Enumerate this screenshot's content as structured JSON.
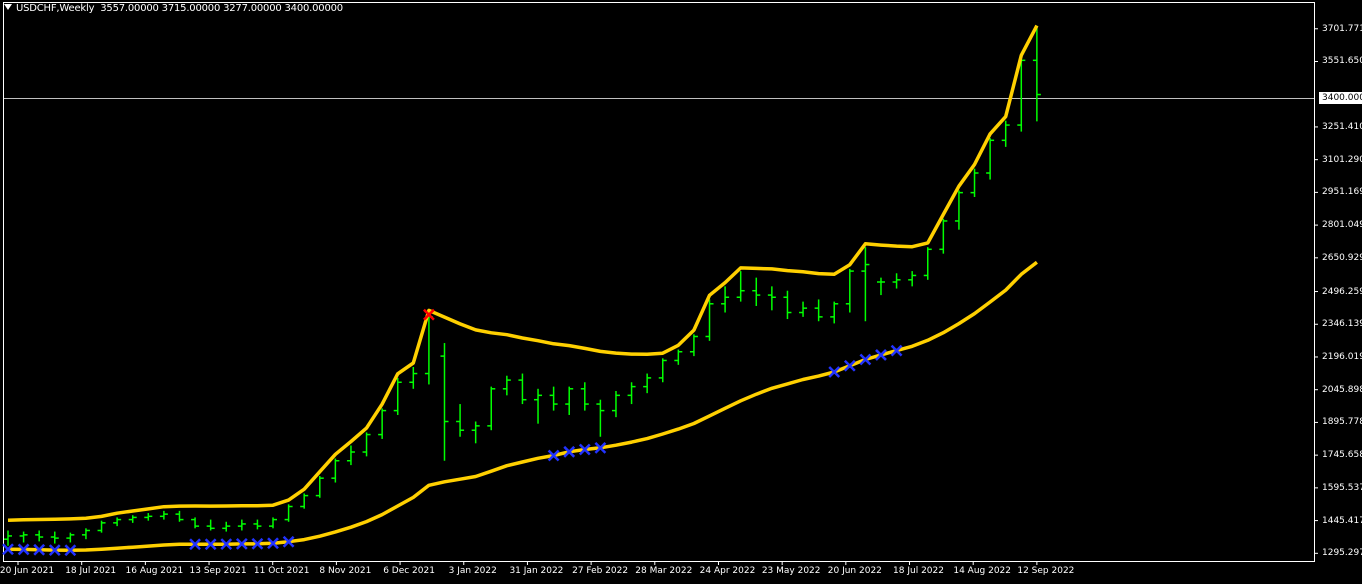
{
  "header": {
    "symbol": "USDCHF,Weekly",
    "ohlc": "3557.00000 3715.00000 3277.00000 3400.00000"
  },
  "current_price_label": "3400.0000",
  "colors": {
    "background": "#000000",
    "frame": "#ffffff",
    "bars": "#00ff00",
    "bands": "#ffd000",
    "marker_blue": "#2233ff",
    "marker_red": "#ff0000"
  },
  "chart_data": {
    "type": "ohlc-bar",
    "y_tick_labels": [
      "3701.7712",
      "3551.6505",
      "3400.0000",
      "3251.4103",
      "3101.2900",
      "2951.1697",
      "2801.0494",
      "2650.9291",
      "2496.2597",
      "2346.1394",
      "2196.0191",
      "2045.8988",
      "1895.7785",
      "1745.6582",
      "1595.5379",
      "1445.4176",
      "1295.2973"
    ],
    "y_tick_values": [
      3701.7712,
      3551.6505,
      3400.0,
      3251.4103,
      3101.29,
      2951.1697,
      2801.0494,
      2650.9291,
      2496.2597,
      2346.1394,
      2196.0191,
      2045.8988,
      1895.7785,
      1745.6582,
      1595.5379,
      1445.4176,
      1295.2973
    ],
    "ylim": [
      1260,
      3820
    ],
    "x_labels": [
      {
        "label": "20 Jun 2021",
        "bar": 0
      },
      {
        "label": "18 Jul 2021",
        "bar": 4
      },
      {
        "label": "16 Aug 2021",
        "bar": 8
      },
      {
        "label": "13 Sep 2021",
        "bar": 12
      },
      {
        "label": "11 Oct 2021",
        "bar": 16
      },
      {
        "label": "8 Nov 2021",
        "bar": 20
      },
      {
        "label": "6 Dec 2021",
        "bar": 24
      },
      {
        "label": "3 Jan 2022",
        "bar": 28
      },
      {
        "label": "31 Jan 2022",
        "bar": 32
      },
      {
        "label": "27 Feb 2022",
        "bar": 36
      },
      {
        "label": "28 Mar 2022",
        "bar": 40
      },
      {
        "label": "24 Apr 2022",
        "bar": 44
      },
      {
        "label": "23 May 2022",
        "bar": 48
      },
      {
        "label": "20 Jun 2022",
        "bar": 52
      },
      {
        "label": "18 Jul 2022",
        "bar": 56
      },
      {
        "label": "14 Aug 2022",
        "bar": 60
      },
      {
        "label": "12 Sep 2022",
        "bar": 64
      }
    ],
    "bars": [
      {
        "o": 1360,
        "h": 1400,
        "l": 1330,
        "c": 1375
      },
      {
        "o": 1375,
        "h": 1395,
        "l": 1345,
        "c": 1380
      },
      {
        "o": 1380,
        "h": 1400,
        "l": 1350,
        "c": 1370
      },
      {
        "o": 1370,
        "h": 1395,
        "l": 1340,
        "c": 1365
      },
      {
        "o": 1365,
        "h": 1390,
        "l": 1345,
        "c": 1380
      },
      {
        "o": 1380,
        "h": 1410,
        "l": 1360,
        "c": 1400
      },
      {
        "o": 1400,
        "h": 1445,
        "l": 1390,
        "c": 1435
      },
      {
        "o": 1435,
        "h": 1460,
        "l": 1420,
        "c": 1450
      },
      {
        "o": 1450,
        "h": 1470,
        "l": 1435,
        "c": 1460
      },
      {
        "o": 1460,
        "h": 1480,
        "l": 1445,
        "c": 1465
      },
      {
        "o": 1465,
        "h": 1490,
        "l": 1450,
        "c": 1475
      },
      {
        "o": 1475,
        "h": 1490,
        "l": 1440,
        "c": 1450
      },
      {
        "o": 1450,
        "h": 1460,
        "l": 1410,
        "c": 1420
      },
      {
        "o": 1420,
        "h": 1450,
        "l": 1400,
        "c": 1410
      },
      {
        "o": 1410,
        "h": 1440,
        "l": 1395,
        "c": 1420
      },
      {
        "o": 1420,
        "h": 1450,
        "l": 1400,
        "c": 1430
      },
      {
        "o": 1430,
        "h": 1450,
        "l": 1405,
        "c": 1420
      },
      {
        "o": 1420,
        "h": 1460,
        "l": 1410,
        "c": 1450
      },
      {
        "o": 1450,
        "h": 1520,
        "l": 1440,
        "c": 1510
      },
      {
        "o": 1510,
        "h": 1570,
        "l": 1500,
        "c": 1560
      },
      {
        "o": 1560,
        "h": 1650,
        "l": 1550,
        "c": 1640
      },
      {
        "o": 1640,
        "h": 1730,
        "l": 1620,
        "c": 1720
      },
      {
        "o": 1720,
        "h": 1790,
        "l": 1700,
        "c": 1760
      },
      {
        "o": 1760,
        "h": 1850,
        "l": 1740,
        "c": 1840
      },
      {
        "o": 1840,
        "h": 1960,
        "l": 1820,
        "c": 1950
      },
      {
        "o": 1950,
        "h": 2100,
        "l": 1930,
        "c": 2080
      },
      {
        "o": 2080,
        "h": 2150,
        "l": 2050,
        "c": 2120
      },
      {
        "o": 2120,
        "h": 2390,
        "l": 2070,
        "c": 2380
      },
      {
        "o": 2200,
        "h": 2260,
        "l": 1720,
        "c": 1900
      },
      {
        "o": 1900,
        "h": 1980,
        "l": 1830,
        "c": 1860
      },
      {
        "o": 1860,
        "h": 1900,
        "l": 1800,
        "c": 1880
      },
      {
        "o": 1880,
        "h": 2060,
        "l": 1860,
        "c": 2050
      },
      {
        "o": 2050,
        "h": 2110,
        "l": 2020,
        "c": 2090
      },
      {
        "o": 2090,
        "h": 2120,
        "l": 1980,
        "c": 2000
      },
      {
        "o": 2000,
        "h": 2050,
        "l": 1890,
        "c": 2020
      },
      {
        "o": 2020,
        "h": 2060,
        "l": 1950,
        "c": 1980
      },
      {
        "o": 1980,
        "h": 2060,
        "l": 1930,
        "c": 2050
      },
      {
        "o": 2050,
        "h": 2080,
        "l": 1950,
        "c": 1980
      },
      {
        "o": 1980,
        "h": 2000,
        "l": 1830,
        "c": 1950
      },
      {
        "o": 1950,
        "h": 2040,
        "l": 1920,
        "c": 2020
      },
      {
        "o": 2020,
        "h": 2080,
        "l": 1980,
        "c": 2060
      },
      {
        "o": 2060,
        "h": 2120,
        "l": 2030,
        "c": 2100
      },
      {
        "o": 2100,
        "h": 2190,
        "l": 2080,
        "c": 2180
      },
      {
        "o": 2180,
        "h": 2230,
        "l": 2160,
        "c": 2220
      },
      {
        "o": 2220,
        "h": 2300,
        "l": 2200,
        "c": 2290
      },
      {
        "o": 2290,
        "h": 2460,
        "l": 2270,
        "c": 2440
      },
      {
        "o": 2440,
        "h": 2520,
        "l": 2400,
        "c": 2470
      },
      {
        "o": 2470,
        "h": 2590,
        "l": 2450,
        "c": 2500
      },
      {
        "o": 2500,
        "h": 2560,
        "l": 2430,
        "c": 2480
      },
      {
        "o": 2480,
        "h": 2520,
        "l": 2410,
        "c": 2470
      },
      {
        "o": 2470,
        "h": 2500,
        "l": 2370,
        "c": 2400
      },
      {
        "o": 2400,
        "h": 2450,
        "l": 2380,
        "c": 2420
      },
      {
        "o": 2420,
        "h": 2460,
        "l": 2360,
        "c": 2380
      },
      {
        "o": 2380,
        "h": 2450,
        "l": 2350,
        "c": 2440
      },
      {
        "o": 2440,
        "h": 2600,
        "l": 2400,
        "c": 2590
      },
      {
        "o": 2590,
        "h": 2700,
        "l": 2360,
        "c": 2620
      },
      {
        "o": 2540,
        "h": 2560,
        "l": 2480,
        "c": 2540
      },
      {
        "o": 2540,
        "h": 2580,
        "l": 2510,
        "c": 2550
      },
      {
        "o": 2550,
        "h": 2590,
        "l": 2520,
        "c": 2570
      }
    ]
  }
}
